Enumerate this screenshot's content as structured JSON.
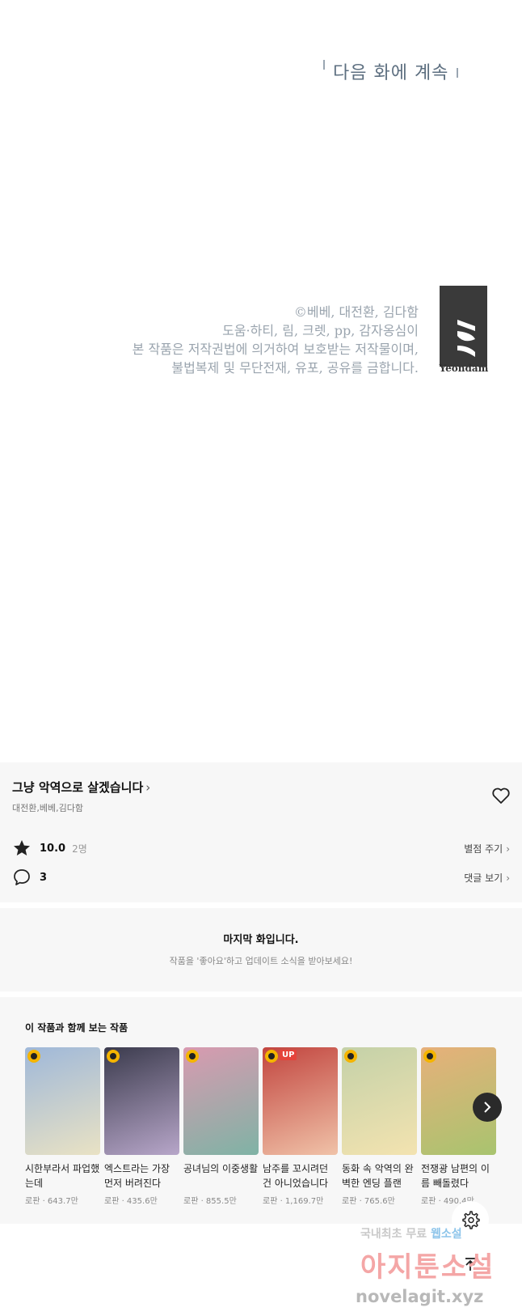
{
  "comic": {
    "next_banner": "다음 화에 계속",
    "credits": [
      "©베베, 대전환, 김다함",
      "도움·하티, 림, 크렛, pp, 감자옹심이",
      "본 작품은 저작권법에 의거하여 보호받는 저작물이며,",
      "불법복제 및 무단전재, 유포, 공유를 금합니다."
    ],
    "publisher": "Yeondam"
  },
  "info": {
    "title": "그냥 악역으로 살겠습니다",
    "authors": "대전환,베베,김다함",
    "rating": "10.0",
    "raters": "2명",
    "rate_link": "별점 주기",
    "comments": "3",
    "comments_link": "댓글 보기"
  },
  "last_episode": {
    "title": "마지막 화입니다.",
    "subtitle": "작품을 '좋아요'하고 업데이트 소식을 받아보세요!"
  },
  "recommendations": {
    "heading": "이 작품과 함께 보는 작품",
    "items": [
      {
        "title": "시한부라서 파업했는데",
        "meta": "로판 · 643.7만",
        "up": false,
        "colors": [
          "#9fb8d9",
          "#e9e2c4"
        ]
      },
      {
        "title": "엑스트라는 가장 먼저 버려진다",
        "meta": "로판 · 435.6만",
        "up": false,
        "colors": [
          "#3b3b4d",
          "#b7a6c9"
        ]
      },
      {
        "title": "공녀님의 이중생활",
        "meta": "로판 · 855.5만",
        "up": false,
        "colors": [
          "#d99ab0",
          "#7fb3a5"
        ]
      },
      {
        "title": "남주를 꼬시려던 건 아니었습니다",
        "meta": "로판 · 1,169.7만",
        "up": true,
        "colors": [
          "#c2453f",
          "#f0c2a8"
        ]
      },
      {
        "title": "동화 속 악역의 완벽한 엔딩 플랜",
        "meta": "로판 · 765.6만",
        "up": false,
        "colors": [
          "#c4d1a8",
          "#f3e3b0"
        ]
      },
      {
        "title": "전쟁광 남편의 이름 빼돌렸다",
        "meta": "로판 · 490.4만",
        "up": false,
        "colors": [
          "#e7b07a",
          "#a8c46f"
        ]
      }
    ]
  },
  "watermark": {
    "line1a": "국내최초 무료",
    "line1b": "웹소설",
    "line2": "아지툰소설",
    "line3": "novelagit.xyz"
  }
}
